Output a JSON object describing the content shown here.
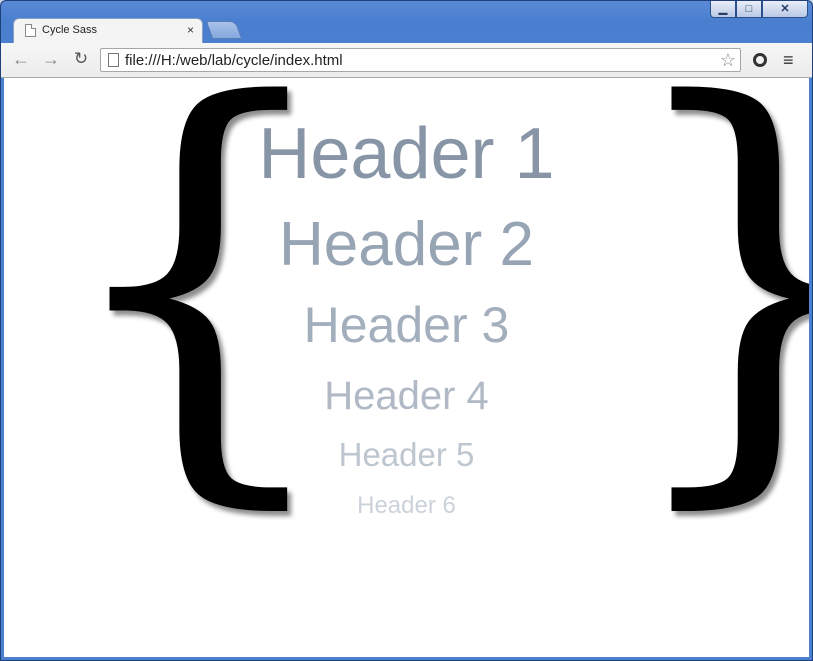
{
  "window": {
    "controls": {
      "minimize": "▁",
      "maximize": "□",
      "close": "✕"
    }
  },
  "tabs": [
    {
      "title": "Cycle Sass",
      "close": "×"
    }
  ],
  "toolbar": {
    "back": "←",
    "forward": "→",
    "reload": "↻",
    "url": "file:///H:/web/lab/cycle/index.html",
    "star": "☆",
    "menu": "≡"
  },
  "page": {
    "left_brace": "{",
    "right_brace": "}",
    "headers": [
      "Header 1",
      "Header 2",
      "Header 3",
      "Header 4",
      "Header 5",
      "Header 6"
    ]
  }
}
